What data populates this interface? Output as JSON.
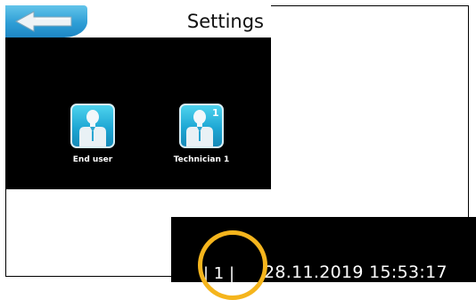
{
  "header": {
    "title": "Settings",
    "back_icon": "back-arrow-icon"
  },
  "users": [
    {
      "label": "End user",
      "icon": "user-icon",
      "badge": ""
    },
    {
      "label": "Technician 1",
      "icon": "user-icon",
      "badge": "1"
    }
  ],
  "status": {
    "page_indicator": "| 1 |",
    "datetime": "28.11.2019 15:53:17"
  },
  "colors": {
    "accent": "#2e9ed6",
    "highlight": "#f5b51d",
    "panel_bg": "#000000"
  }
}
